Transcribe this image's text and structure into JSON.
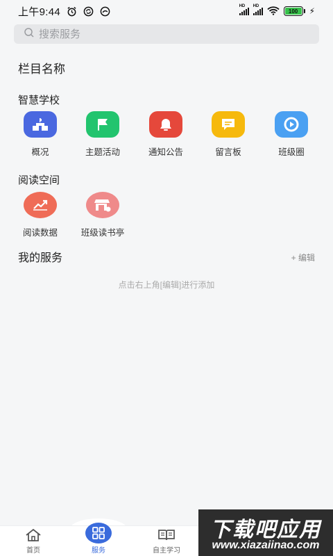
{
  "status_bar": {
    "time": "上午9:44",
    "signal_badge_1": "HD",
    "signal_badge_2": "HD",
    "battery_level": "100",
    "icons": [
      "alarm-icon",
      "sync-icon",
      "data-saver-icon",
      "signal-icon",
      "wifi-icon",
      "battery-icon",
      "charging-icon"
    ]
  },
  "search": {
    "placeholder": "搜索服务"
  },
  "column_title": "栏目名称",
  "smart_school": {
    "title": "智慧学校",
    "items": [
      {
        "label": "概况",
        "icon": "school-building-icon",
        "color": "#4a68e0"
      },
      {
        "label": "主题活动",
        "icon": "flag-icon",
        "color": "#22c46e"
      },
      {
        "label": "通知公告",
        "icon": "bell-icon",
        "color": "#e5483b"
      },
      {
        "label": "留言板",
        "icon": "message-icon",
        "color": "#f6b90d"
      },
      {
        "label": "班级圈",
        "icon": "class-circle-icon",
        "color": "#4aa0f2"
      }
    ]
  },
  "reading_space": {
    "title": "阅读空间",
    "items": [
      {
        "label": "阅读数据",
        "icon": "trend-chart-icon",
        "color": "#ef6c57"
      },
      {
        "label": "班级读书亭",
        "icon": "book-kiosk-icon",
        "color": "#ef8a8a"
      }
    ]
  },
  "my_services": {
    "title": "我的服务",
    "edit_label": "+ 编辑",
    "empty_hint": "点击右上角[编辑]进行添加"
  },
  "bottom_nav": {
    "items": [
      {
        "label": "首页",
        "icon": "home-icon"
      },
      {
        "label": "服务",
        "icon": "grid-icon",
        "active": true
      },
      {
        "label": "自主学习",
        "icon": "open-book-icon"
      }
    ]
  },
  "watermark": {
    "line1": "下载吧应用",
    "line2": "www.xiazaiinao.com"
  },
  "colors": {
    "accent": "#3a6bdc",
    "background": "#f5f6f7"
  }
}
